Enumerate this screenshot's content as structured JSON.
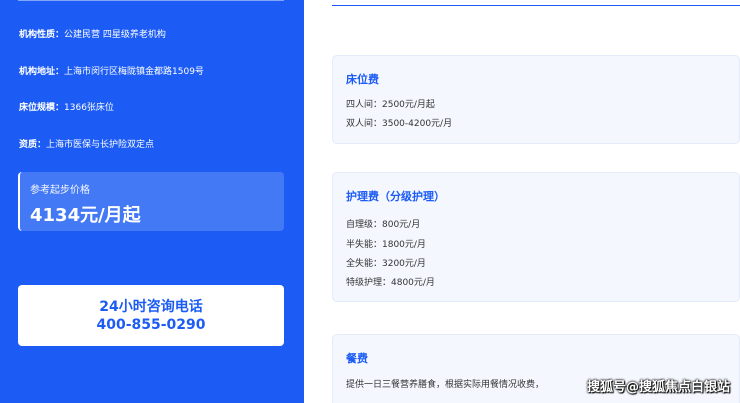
{
  "left": {
    "nature_key": "机构性质：",
    "nature_val": "公建民营 四星级养老机构",
    "address_key": "机构地址：",
    "address_val": "上海市闵行区梅陇镇金都路1509号",
    "beds_key": "床位规模：",
    "beds_val": "1366张床位",
    "qual_key": "资质：",
    "qual_val": "上海市医保与长护险双定点",
    "price_caption": "参考起步价格",
    "price_value": "4134元/月起",
    "phone_title": "24小时咨询电话",
    "phone_number": "400-855-0290"
  },
  "fees": {
    "bed": {
      "title": "床位费",
      "lines": [
        "四人间：2500元/月起",
        "双人间：3500-4200元/月"
      ]
    },
    "care": {
      "title": "护理费（分级护理）",
      "lines": [
        "自理级：800元/月",
        "半失能：1800元/月",
        "全失能：3200元/月",
        "特级护理：4800元/月"
      ]
    },
    "meal": {
      "title": "餐费",
      "lines": [
        "提供一日三餐营养膳食，根据实际用餐情况收费，"
      ]
    }
  },
  "watermark": "搜狐号@搜狐焦点白银站",
  "colors": {
    "brand_blue": "#1c5cf5",
    "card_bg": "#f4f7fe"
  }
}
